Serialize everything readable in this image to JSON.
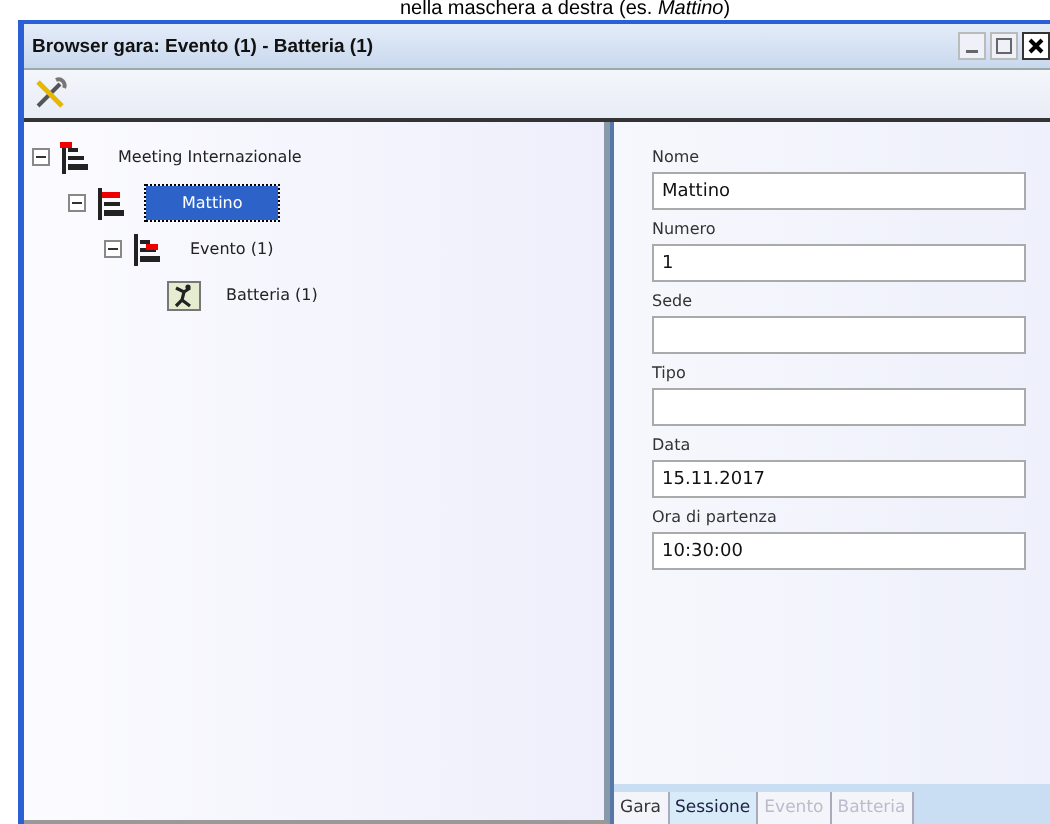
{
  "caption": "nella maschera a destra (es. *Mattino*)",
  "window": {
    "title": "Browser gara: Evento (1) - Batteria (1)"
  },
  "tree": [
    {
      "label": "Meeting  Internazionale",
      "kind": "meeting",
      "expanded": true,
      "selected": false,
      "children": [
        {
          "label": "Mattino",
          "kind": "session",
          "expanded": true,
          "selected": true,
          "children": [
            {
              "label": "Evento (1)",
              "kind": "event",
              "expanded": true,
              "selected": false,
              "children": [
                {
                  "label": "Batteria (1)",
                  "kind": "heat",
                  "selected": false
                }
              ]
            }
          ]
        }
      ]
    }
  ],
  "form": {
    "fields": [
      {
        "label": "Nome",
        "value": "Mattino"
      },
      {
        "label": "Numero",
        "value": "1"
      },
      {
        "label": "Sede"
      },
      {
        "label": "Tipo"
      },
      {
        "label": "Data",
        "value": "15.11.2017"
      },
      {
        "label": "Ora di partenza",
        "value": "10:30:00"
      }
    ]
  },
  "tabs": [
    {
      "label": "Gara",
      "selected": false,
      "disabled": false
    },
    {
      "label": "Sessione",
      "selected": true,
      "disabled": false
    },
    {
      "label": "Evento",
      "selected": false,
      "disabled": true
    },
    {
      "label": "Batteria",
      "selected": false,
      "disabled": true
    }
  ]
}
